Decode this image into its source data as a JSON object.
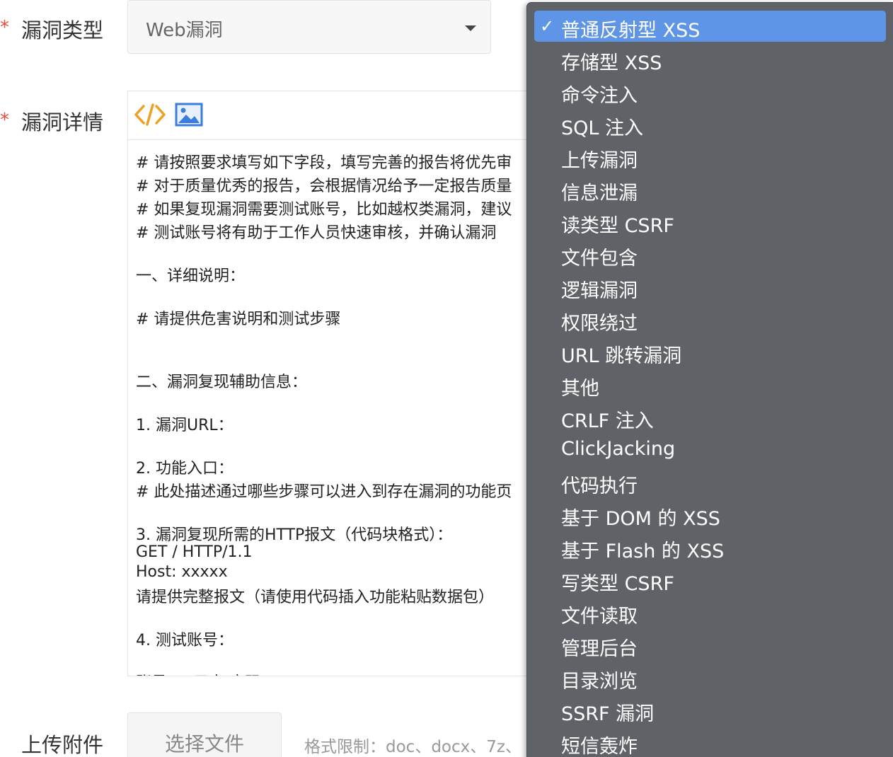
{
  "form": {
    "vuln_type": {
      "label": "漏洞类型",
      "value": "Web漏洞"
    },
    "vuln_detail": {
      "label": "漏洞详情"
    },
    "upload": {
      "label": "上传附件",
      "button_label": "选择文件",
      "format_hint": "格式限制：doc、docx、7z、"
    }
  },
  "editor": {
    "toolbar": {
      "code_icon": "code-icon",
      "image_icon": "image-icon"
    },
    "lines": [
      "# 请按照要求填写如下字段，填写完善的报告将优先审",
      "# 对于质量优秀的报告，会根据情况给予一定报告质量",
      "# 如果复现漏洞需要测试账号，比如越权类漏洞，建议",
      "# 测试账号将有助于工作人员快速审核，并确认漏洞",
      "一、详细说明：",
      "# 请提供危害说明和测试步骤",
      "二、漏洞复现辅助信息：",
      "1. 漏洞URL：",
      "2. 功能入口：",
      "# 此处描述通过哪些步骤可以进入到存在漏洞的功能页",
      "3. 漏洞复现所需的HTTP报文（代码块格式）：",
      "GET / HTTP/1.1",
      "Host: xxxxx",
      "请提供完整报文（请使用代码插入功能粘贴数据包）",
      "4. 测试账号：",
      "账号A：用户/密码"
    ]
  },
  "dropdown": {
    "check_mark": "✓",
    "options": [
      {
        "label": "普通反射型 XSS",
        "selected": true
      },
      {
        "label": "存储型 XSS"
      },
      {
        "label": "命令注入"
      },
      {
        "label": "SQL 注入"
      },
      {
        "label": "上传漏洞"
      },
      {
        "label": "信息泄漏"
      },
      {
        "label": "读类型 CSRF"
      },
      {
        "label": "文件包含"
      },
      {
        "label": "逻辑漏洞"
      },
      {
        "label": "权限绕过"
      },
      {
        "label": "URL 跳转漏洞"
      },
      {
        "label": "其他"
      },
      {
        "label": "CRLF 注入"
      },
      {
        "label": "ClickJacking"
      },
      {
        "label": "代码执行"
      },
      {
        "label": "基于 DOM 的 XSS"
      },
      {
        "label": "基于 Flash 的 XSS"
      },
      {
        "label": "写类型 CSRF"
      },
      {
        "label": "文件读取"
      },
      {
        "label": "管理后台"
      },
      {
        "label": "目录浏览"
      },
      {
        "label": "SSRF 漏洞"
      },
      {
        "label": "短信轰炸"
      }
    ]
  },
  "colors": {
    "required_star": "#e74c3c",
    "dropdown_bg": "#5f6266",
    "dropdown_selected": "#5f95e6",
    "code_icon": "#f0a020",
    "image_icon": "#3b7ddd"
  }
}
